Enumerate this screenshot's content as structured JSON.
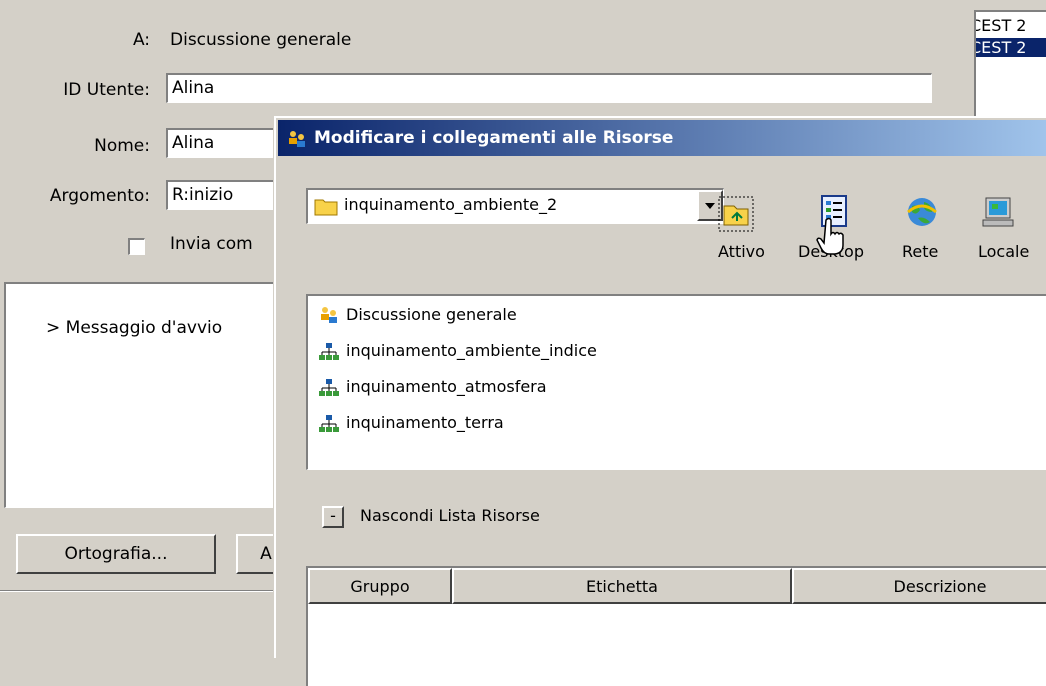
{
  "form": {
    "to_label": "A:",
    "to_value": "Discussione generale",
    "userid_label": "ID Utente:",
    "userid_value": "Alina",
    "name_label": "Nome:",
    "name_value": "Alina",
    "topic_label": "Argomento:",
    "topic_value": "R:inizio",
    "send_label": "Invia com",
    "message_text": "> Messaggio d'avvio",
    "spell_button": "Ortografia...",
    "second_button": "A"
  },
  "side_list": {
    "items": [
      "CEST 2",
      "CEST 2"
    ]
  },
  "dialog": {
    "title": "Modificare i collegamenti alle Risorse",
    "folder_value": "inquinamento_ambiente_2",
    "toolbar": [
      {
        "label": "Attivo",
        "icon": "folder-up-icon"
      },
      {
        "label": "Desktop",
        "icon": "desktop-icon"
      },
      {
        "label": "Rete",
        "icon": "network-icon"
      },
      {
        "label": "Locale",
        "icon": "computer-icon"
      }
    ],
    "resources": [
      "Discussione generale",
      "inquinamento_ambiente_indice",
      "inquinamento_atmosfera",
      "inquinamento_terra"
    ],
    "toggle_symbol": "-",
    "toggle_label": "Nascondi Lista Risorse",
    "columns": [
      "Gruppo",
      "Etichetta",
      "Descrizione"
    ]
  }
}
